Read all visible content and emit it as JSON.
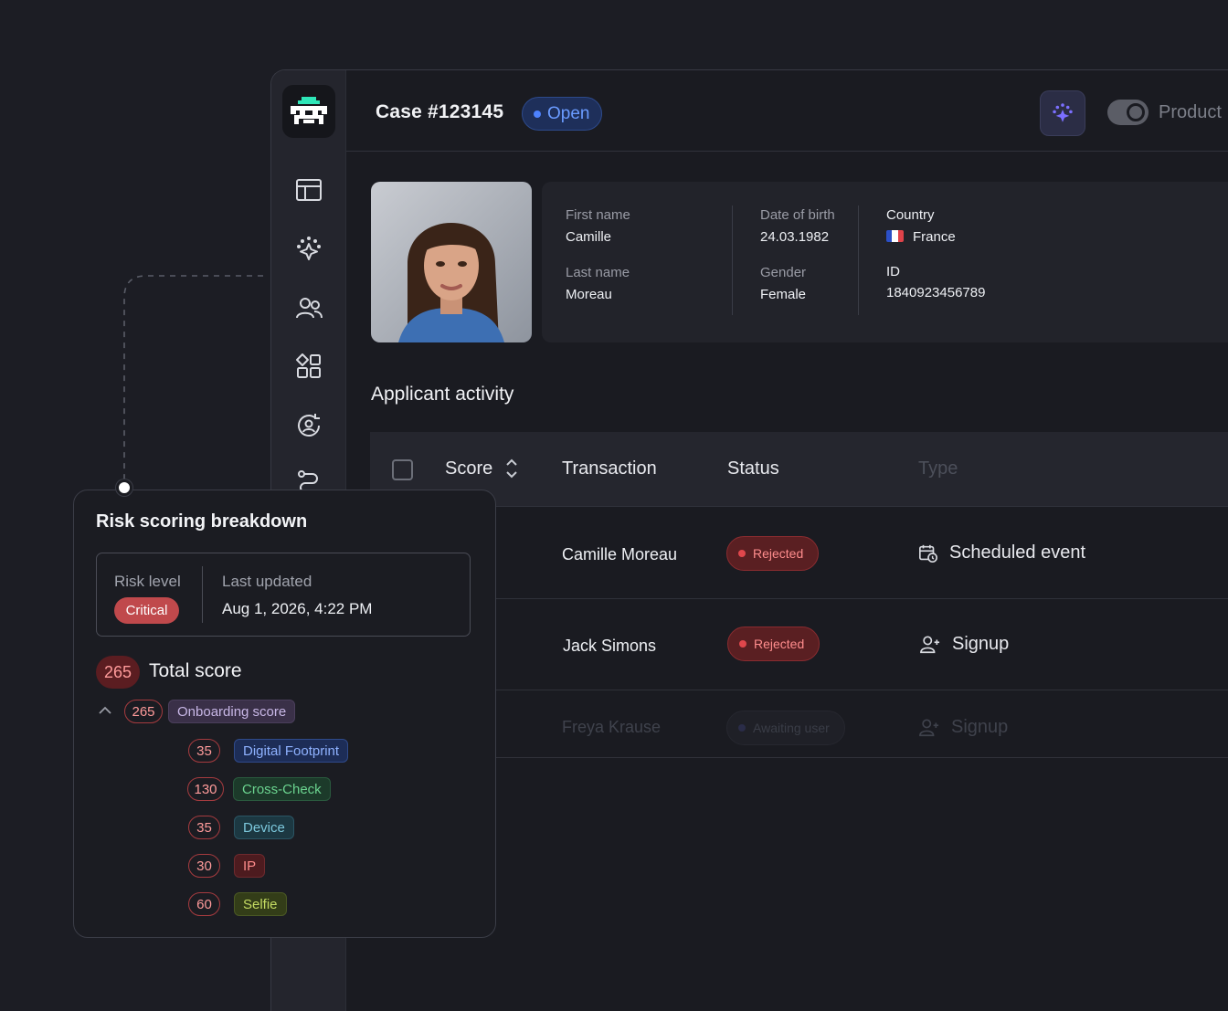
{
  "header": {
    "case_title": "Case #123145",
    "status": "Open",
    "toggle_label": "Product"
  },
  "sidebar": {
    "items": [
      {
        "icon": "layout-icon"
      },
      {
        "icon": "sparkle-paw-icon"
      },
      {
        "icon": "users-icon"
      },
      {
        "icon": "widgets-icon"
      },
      {
        "icon": "user-refresh-icon"
      },
      {
        "icon": "route-icon"
      }
    ]
  },
  "applicant": {
    "first_name_label": "First name",
    "first_name": "Camille",
    "last_name_label": "Last name",
    "last_name": "Moreau",
    "dob_label": "Date of birth",
    "dob": "24.03.1982",
    "gender_label": "Gender",
    "gender": "Female",
    "country_label": "Country",
    "country": "France",
    "id_label": "ID",
    "id": "1840923456789"
  },
  "activity": {
    "title": "Applicant activity",
    "columns": {
      "score": "Score",
      "transaction": "Transaction",
      "status": "Status",
      "type": "Type"
    },
    "rows": [
      {
        "name": "Camille Moreau",
        "status": "Rejected",
        "type": "Scheduled event"
      },
      {
        "name": "Jack Simons",
        "status": "Rejected",
        "type": "Signup"
      },
      {
        "name": "Freya Krause",
        "status": "Awaiting user",
        "type": "Signup"
      }
    ]
  },
  "risk": {
    "title": "Risk scoring breakdown",
    "risk_level_label": "Risk level",
    "risk_level": "Critical",
    "last_updated_label": "Last updated",
    "last_updated": "Aug 1, 2026, 4:22 PM",
    "total_score": "265",
    "total_label": "Total score",
    "onboarding_score": "265",
    "onboarding_label": "Onboarding score",
    "items": [
      {
        "score": "35",
        "label": "Digital Footprint"
      },
      {
        "score": "130",
        "label": "Cross-Check"
      },
      {
        "score": "35",
        "label": "Device"
      },
      {
        "score": "30",
        "label": "IP"
      },
      {
        "score": "60",
        "label": "Selfie"
      }
    ]
  },
  "colors": {
    "background": "#1c1d24",
    "accent_blue": "#4d82ff",
    "critical_red": "#c0494c"
  }
}
